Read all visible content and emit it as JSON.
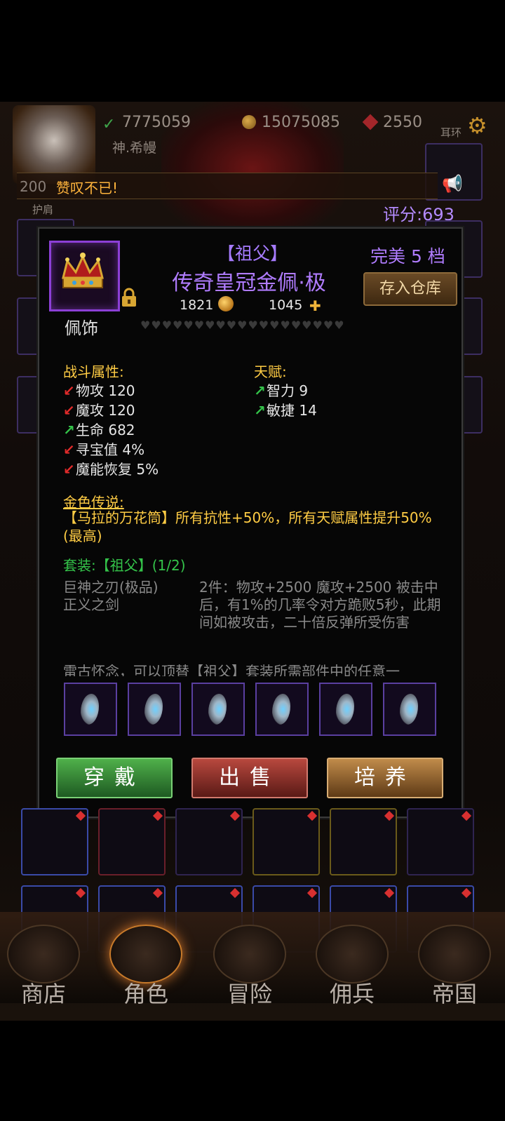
{
  "top_bar": {
    "stat_green": "7775059",
    "stat_gold": "15075085",
    "stat_gem": "2550",
    "earring_label": "耳环",
    "player_name": "神.希幔",
    "chat_num": "200",
    "chat_text": "赞叹不已!",
    "shoulder_label": "护肩",
    "score_text": "评分:693"
  },
  "item": {
    "set_name": "【祖父】",
    "name": "传奇皇冠金佩·极",
    "grade": "完美 5 档",
    "store_button": "存入仓库",
    "gold_value": "1821",
    "piece_value": "1045",
    "slot_type": "佩饰",
    "hearts": "♥♥♥♥♥♥♥♥♥♥♥♥♥♥♥♥♥♥♥"
  },
  "combat": {
    "title": "战斗属性:",
    "stats": [
      {
        "dir": "down",
        "text": "物攻 120"
      },
      {
        "dir": "down",
        "text": "魔攻 120"
      },
      {
        "dir": "up",
        "text": "生命 682"
      },
      {
        "dir": "down",
        "text": "寻宝值 4%"
      },
      {
        "dir": "down",
        "text": "魔能恢复 5%"
      }
    ]
  },
  "talent": {
    "title": "天赋:",
    "stats": [
      {
        "dir": "up",
        "text": "智力 9"
      },
      {
        "dir": "up",
        "text": "敏捷 14"
      }
    ]
  },
  "legend": {
    "title": "金色传说:",
    "text": "【马拉的万花筒】所有抗性+50%，所有天赋属性提升50%(最高)"
  },
  "suit": {
    "title": "套装:【祖父】(1/2)",
    "piece1": "巨神之刃(极品)",
    "piece2": "正义之剑",
    "effect": "2件：物攻+2500 魔攻+2500 被击中后，有1%的几率令对方跪败5秒，此期间如被攻击，二十倍反弹所受伤害",
    "stone_note": "雷古怀念，可以顶替【祖父】套装所需部件中的任意一"
  },
  "actions": {
    "wear": "穿戴",
    "sell": "出售",
    "train": "培养"
  },
  "nav": {
    "shop": "商店",
    "role": "角色",
    "adventure": "冒险",
    "mercenary": "佣兵",
    "empire": "帝国"
  },
  "colors": {
    "purple": "#b07cff",
    "gold_text": "#ffcc44",
    "green_text": "#34c44a",
    "down_arrow": "#e02a2a",
    "up_arrow": "#34c44a"
  }
}
